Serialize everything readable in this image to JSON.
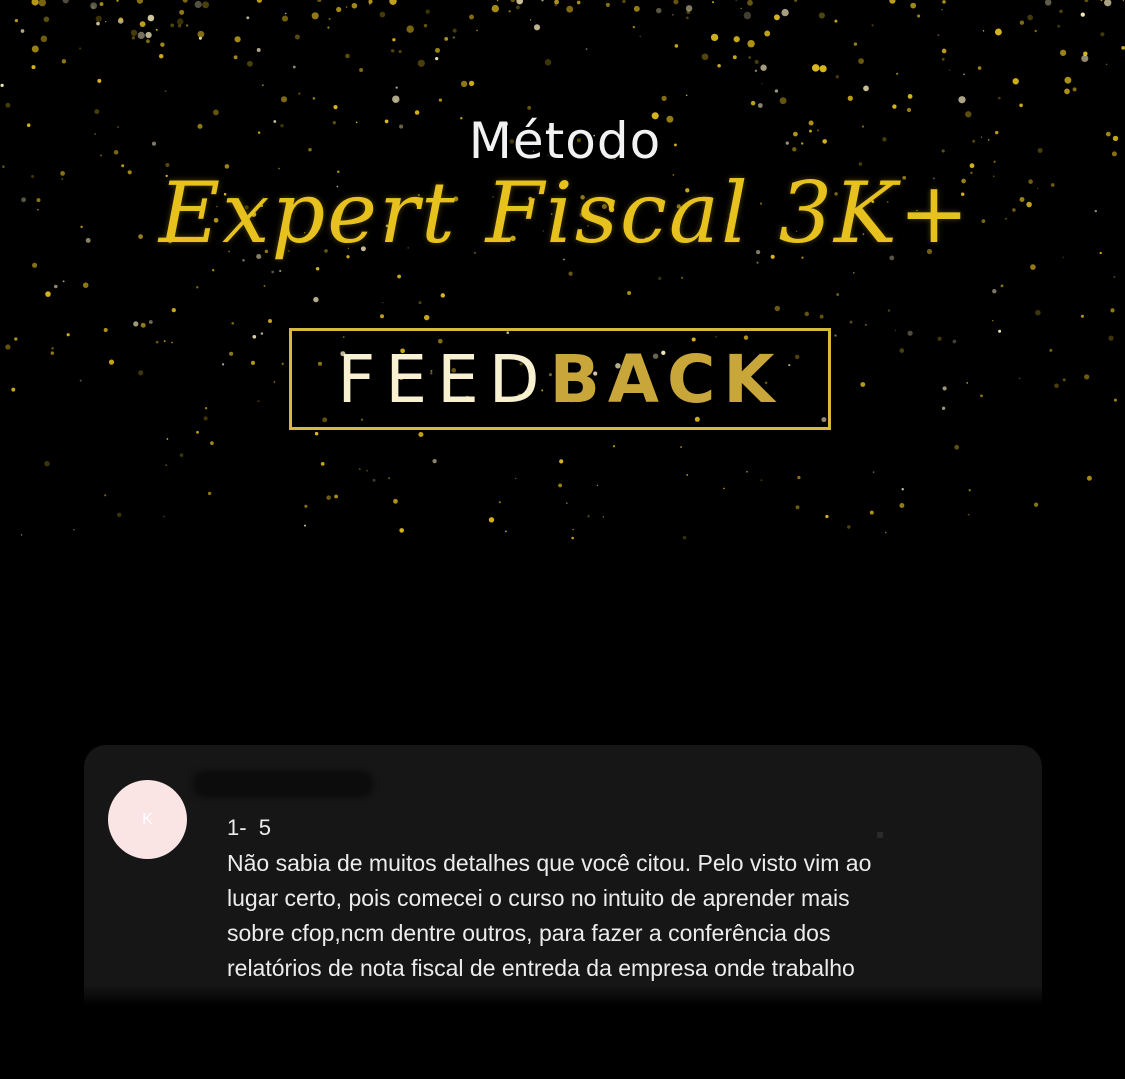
{
  "banner": {
    "pre_title": "Método",
    "script_title": "Expert Fiscal 3K+",
    "feedback_light": "FEED",
    "feedback_bold": "BACK"
  },
  "colors": {
    "gold": "#e7c21f",
    "gold_dark": "#c9a63a",
    "card": "#161616",
    "avatar": "#fbe4e4"
  },
  "comment_card": {
    "avatar_initial": "K",
    "rating": "1-  5",
    "lines": [
      "Não sabia de muitos detalhes que você citou. Pelo visto vim ao",
      "lugar certo, pois comecei o curso no intuito de aprender mais",
      "sobre cfop,ncm dentre outros, para fazer a conferência dos",
      "relatórios de nota fiscal de entreda da empresa onde trabalho"
    ]
  }
}
